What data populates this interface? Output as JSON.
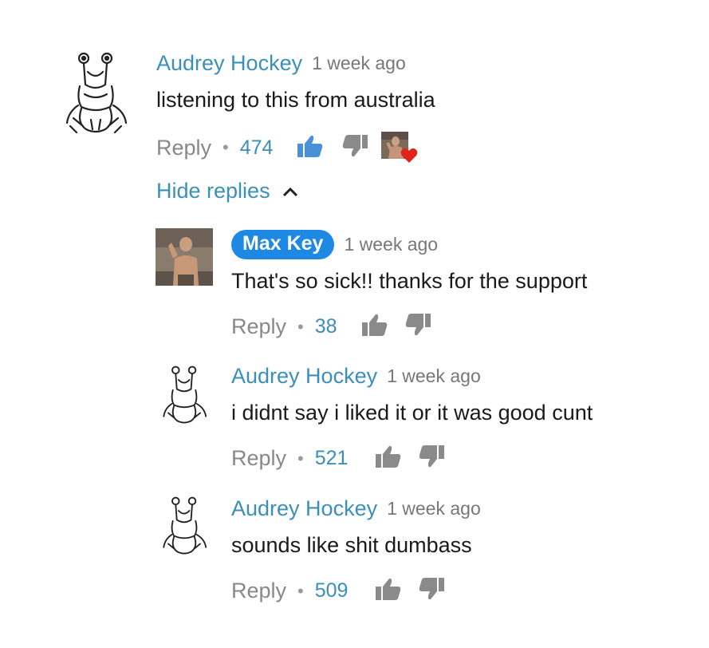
{
  "comments": [
    {
      "author": "Audrey Hockey",
      "time": "1 week ago",
      "text": "listening to this from australia",
      "reply_label": "Reply",
      "likes": "474"
    },
    {
      "author": "Max Key",
      "time": "1 week ago",
      "text": "That's so sick!! thanks for the support",
      "reply_label": "Reply",
      "likes": "38"
    },
    {
      "author": "Audrey Hockey",
      "time": "1 week ago",
      "text": "i didnt say i liked it or it was good cunt",
      "reply_label": "Reply",
      "likes": "521"
    },
    {
      "author": "Audrey Hockey",
      "time": "1 week ago",
      "text": "sounds like shit dumbass",
      "reply_label": "Reply",
      "likes": "509"
    }
  ],
  "hide_replies_label": "Hide replies",
  "separator": "•",
  "colors": {
    "link_blue": "#3b8fb8",
    "chip_blue": "#1e88e5",
    "liked_blue": "#4a90d9",
    "thumb_gray": "#8a8a8a",
    "heart_red": "#e0241b"
  },
  "icons": {
    "like": "thumbs-up-icon",
    "dislike": "thumbs-down-icon",
    "creator_heart": "heart-icon",
    "collapse": "chevron-up-icon"
  }
}
